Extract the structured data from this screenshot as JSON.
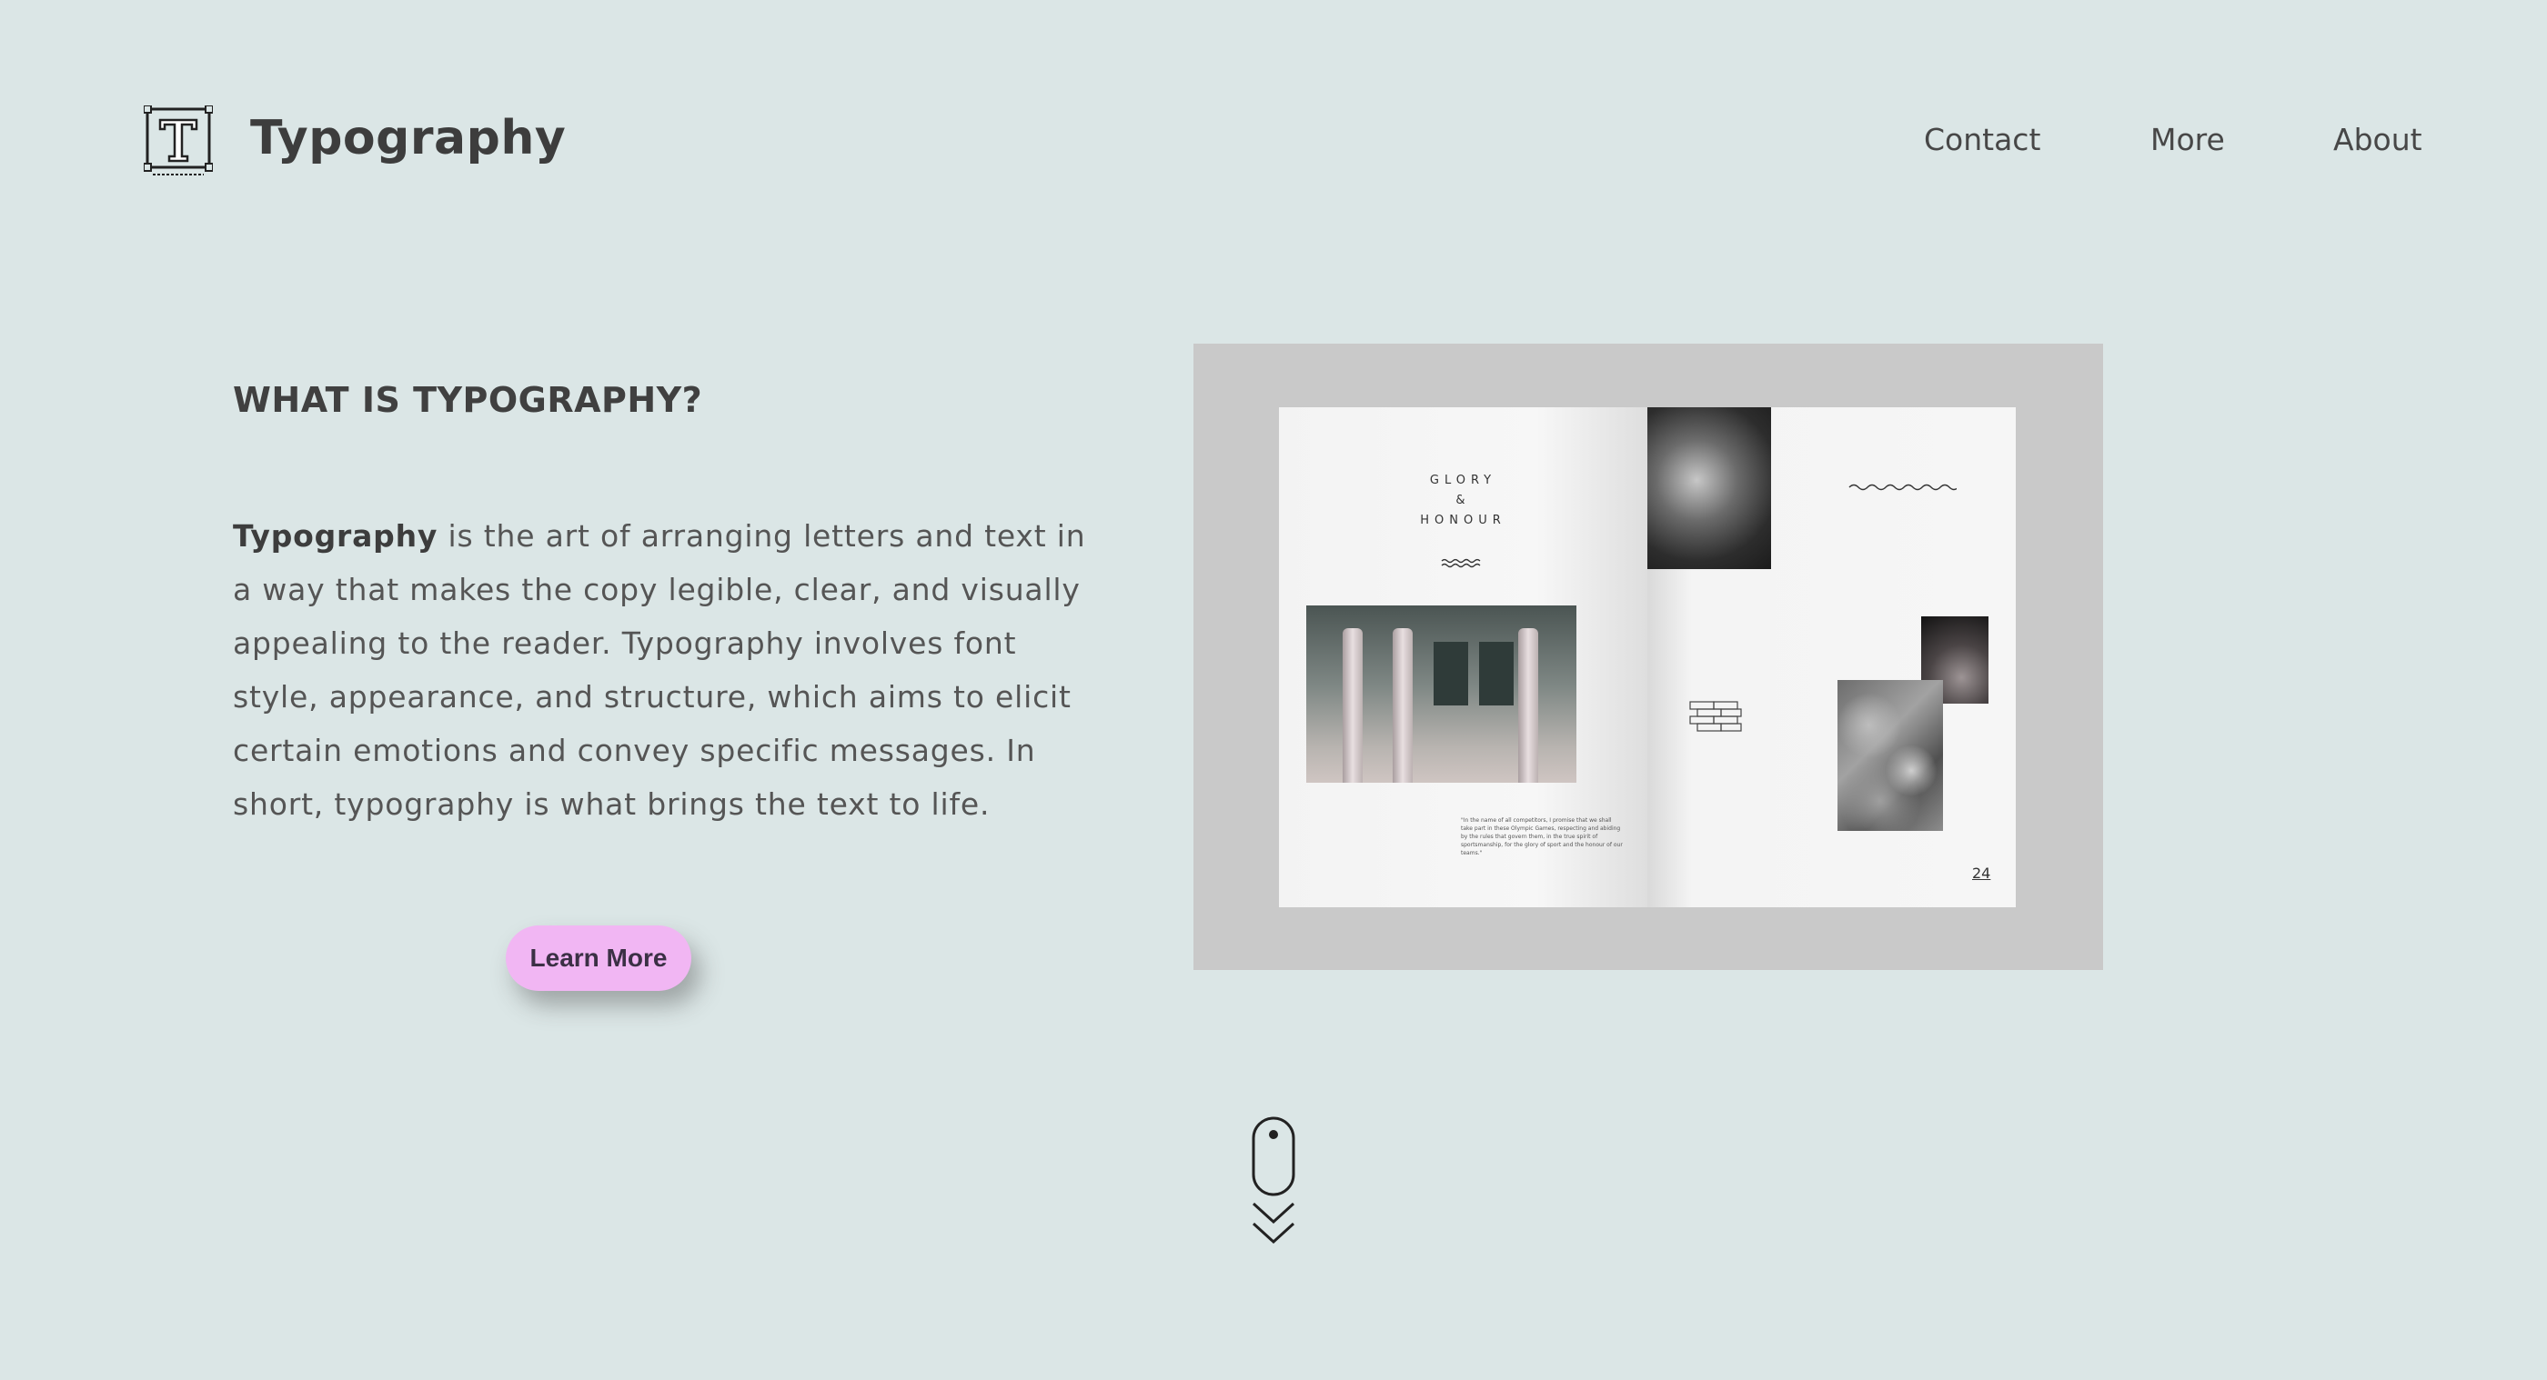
{
  "header": {
    "brand": "Typography",
    "logo_icon": "typography-frame-icon",
    "nav": {
      "contact": "Contact",
      "more": "More",
      "about": "About"
    }
  },
  "main": {
    "heading": "WHAT IS TYPOGRAPHY?",
    "paragraph_bold": "Typography",
    "paragraph_rest": " is the art of arranging letters and text in a way that makes the copy legible, clear, and visually appealing to the reader. Typography involves font style, appearance, and structure, which aims to elicit certain emotions and convey specific messages. In short, typography is what brings the text to life.",
    "button_label": "Learn More",
    "button_color": "#f1b6f3"
  },
  "magazine": {
    "title_line1": "GLORY",
    "title_line2": "&",
    "title_line3": "HONOUR",
    "quote": "\"In the name of all competitors, I promise that we shall take part in these Olympic Games, respecting and abiding by the rules that govern them, in the true spirit of sportsmanship, for the glory of sport and the honour of our teams.\"",
    "page_number": "24"
  },
  "scroll_icon": "mouse-scroll-down-icon",
  "colors": {
    "background": "#dbe6e6",
    "text": "#3f3f3f"
  }
}
